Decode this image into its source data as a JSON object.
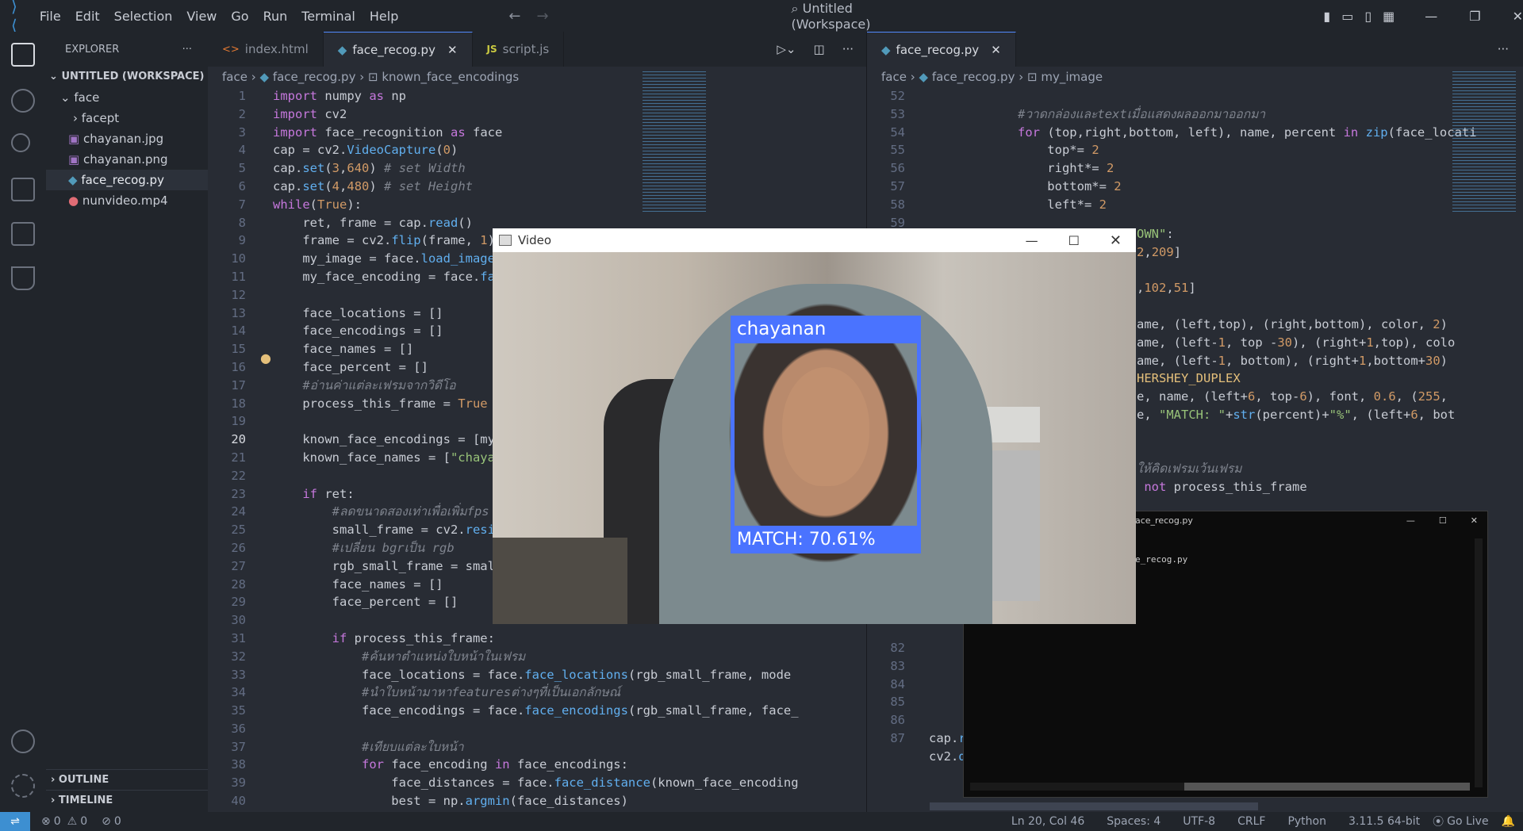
{
  "menu": [
    "File",
    "Edit",
    "Selection",
    "View",
    "Go",
    "Run",
    "Terminal",
    "Help"
  ],
  "window_title": "Untitled (Workspace)",
  "explorer": {
    "title": "EXPLORER",
    "workspace": "UNTITLED (WORKSPACE)",
    "folder": "face",
    "items": [
      {
        "name": "facept",
        "kind": "folder"
      },
      {
        "name": "chayanan.jpg",
        "kind": "image"
      },
      {
        "name": "chayanan.png",
        "kind": "image"
      },
      {
        "name": "face_recog.py",
        "kind": "python"
      },
      {
        "name": "nunvideo.mp4",
        "kind": "video"
      }
    ],
    "outline": "OUTLINE",
    "timeline": "TIMELINE"
  },
  "left_tabs": [
    {
      "label": "index.html",
      "icon": "<>"
    },
    {
      "label": "face_recog.py",
      "icon": "py"
    },
    {
      "label": "script.js",
      "icon": "JS"
    }
  ],
  "left_crumbs": [
    "face",
    "face_recog.py",
    "known_face_encodings"
  ],
  "right_tab": "face_recog.py",
  "right_crumbs": [
    "face",
    "face_recog.py",
    "my_image"
  ],
  "video_window": {
    "title": "Video",
    "name_label": "chayanan",
    "match_label": "MATCH:  70.61%"
  },
  "terminal_window": {
    "title": "ace_recog.py",
    "line": "e_recog.py"
  },
  "status": {
    "errors": "0",
    "warnings": "0",
    "ports": "0",
    "position": "Ln 20, Col 46",
    "spaces": "Spaces: 4",
    "encoding": "UTF-8",
    "eol": "CRLF",
    "language": "Python",
    "interpreter": "3.11.5 64-bit",
    "golive": "Go Live"
  },
  "colors": {
    "accent": "#528bff",
    "face_box": "#4a73ff",
    "status_remote": "#3d8fd1"
  }
}
